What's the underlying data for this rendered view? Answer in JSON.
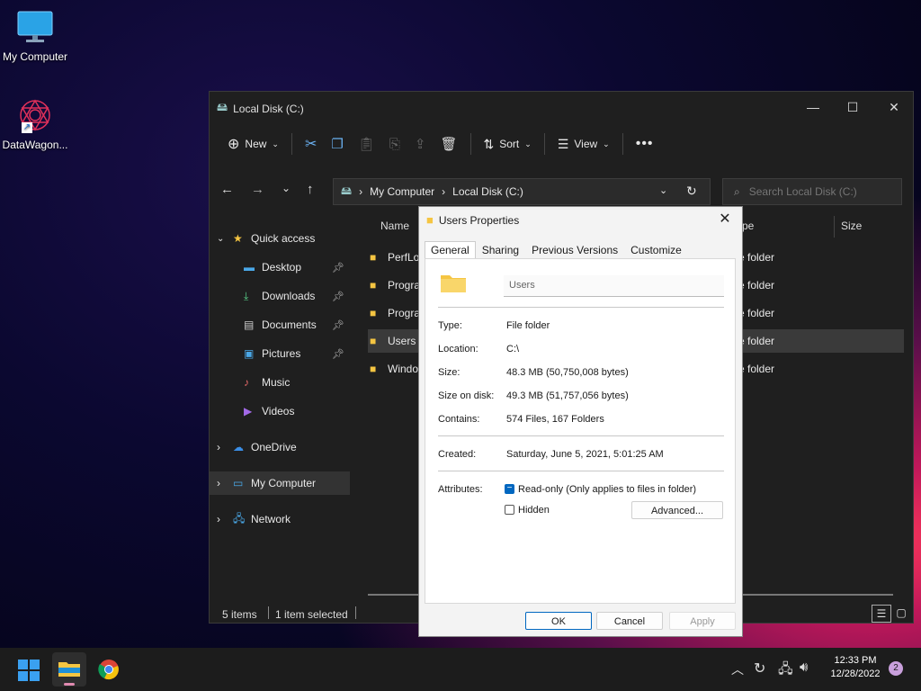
{
  "desktop": {
    "icons": [
      {
        "label": "My Computer"
      },
      {
        "label": "DataWagon..."
      }
    ]
  },
  "explorer": {
    "title": "Local Disk (C:)",
    "toolbar": {
      "new": "New",
      "sort": "Sort",
      "view": "View"
    },
    "address": {
      "crumbs": [
        "My Computer",
        "Local Disk (C:)"
      ]
    },
    "search": {
      "placeholder": "Search Local Disk (C:)"
    },
    "nav": {
      "quick_access": "Quick access",
      "items": [
        "Desktop",
        "Downloads",
        "Documents",
        "Pictures",
        "Music",
        "Videos"
      ],
      "onedrive": "OneDrive",
      "my_computer": "My Computer",
      "network": "Network"
    },
    "columns": {
      "name": "Name",
      "type": "pe",
      "size": "Size"
    },
    "rows": [
      {
        "name": "PerfLo",
        "type": "e folder"
      },
      {
        "name": "Progra",
        "type": "e folder"
      },
      {
        "name": "Progra",
        "type": "e folder"
      },
      {
        "name": "Users",
        "type": "e folder"
      },
      {
        "name": "Windo",
        "type": "e folder"
      }
    ],
    "status": {
      "count": "5 items",
      "selected": "1 item selected"
    }
  },
  "dialog": {
    "title": "Users Properties",
    "tabs": [
      "General",
      "Sharing",
      "Previous Versions",
      "Customize"
    ],
    "name_value": "Users",
    "type_label": "Type:",
    "type_value": "File folder",
    "location_label": "Location:",
    "location_value": "C:\\",
    "size_label": "Size:",
    "size_value": "48.3 MB (50,750,008 bytes)",
    "disk_label": "Size on disk:",
    "disk_value": "49.3 MB (51,757,056 bytes)",
    "contains_label": "Contains:",
    "contains_value": "574 Files, 167 Folders",
    "created_label": "Created:",
    "created_value": "Saturday, June 5, 2021, 5:01:25 AM",
    "attributes_label": "Attributes:",
    "readonly_label": "Read-only (Only applies to files in folder)",
    "hidden_label": "Hidden",
    "advanced_label": "Advanced...",
    "ok_label": "OK",
    "cancel_label": "Cancel",
    "apply_label": "Apply"
  },
  "taskbar": {
    "time": "12:33 PM",
    "date": "12/28/2022",
    "notification_count": "2"
  },
  "colors": {
    "accent": "#0067c0",
    "folder": "#f5c542"
  }
}
